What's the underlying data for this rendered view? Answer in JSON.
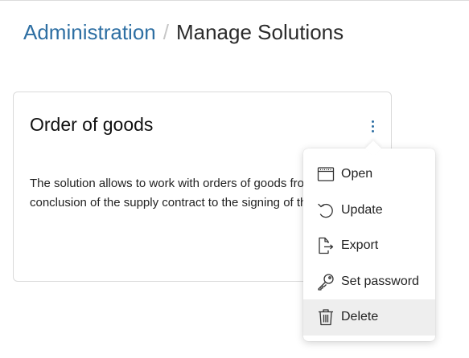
{
  "breadcrumb": {
    "parent": "Administration",
    "separator": "/",
    "current": "Manage Solutions"
  },
  "card": {
    "title": "Order of goods",
    "description_line1": "The solution allows to work with orders of goods from the",
    "description_line2": "conclusion of the supply contract to the signing of the"
  },
  "menu": {
    "items": [
      {
        "label": "Open",
        "icon": "window-icon"
      },
      {
        "label": "Update",
        "icon": "refresh-icon"
      },
      {
        "label": "Export",
        "icon": "export-icon"
      },
      {
        "label": "Set password",
        "icon": "key-icon"
      },
      {
        "label": "Delete",
        "icon": "trash-icon",
        "highlighted": true
      }
    ]
  },
  "colors": {
    "link": "#2e6fa3",
    "menu_highlight": "#eeeeee"
  }
}
